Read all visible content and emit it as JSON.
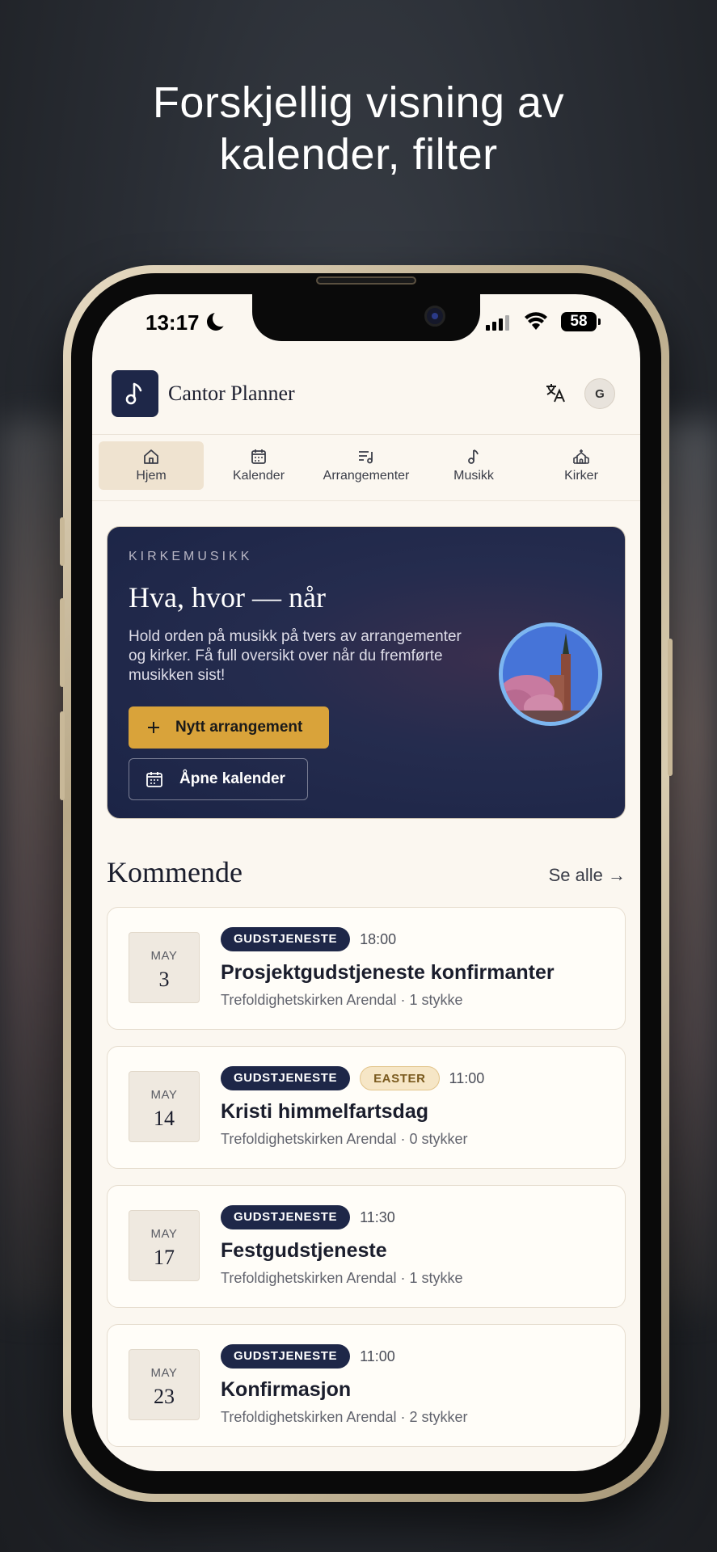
{
  "headline": {
    "line1": "Forskjellig visning av",
    "line2": "kalender, filter"
  },
  "status_bar": {
    "time": "13:17",
    "battery": "58"
  },
  "app": {
    "title": "Cantor Planner",
    "avatar_initial": "G"
  },
  "nav": {
    "items": [
      {
        "label": "Hjem",
        "icon": "home-icon",
        "active": true
      },
      {
        "label": "Kalender",
        "icon": "calendar-icon"
      },
      {
        "label": "Arrangementer",
        "icon": "list-music-icon"
      },
      {
        "label": "Musikk",
        "icon": "music-note-icon"
      },
      {
        "label": "Kirker",
        "icon": "church-icon"
      }
    ]
  },
  "hero": {
    "eyebrow": "KIRKEMUSIKK",
    "title": "Hva, hvor — når",
    "description": "Hold orden på musikk på tvers av arrangementer og kirker. Få full oversikt over når du fremførte musikken sist!",
    "primary_button": "Nytt arrangement",
    "secondary_button": "Åpne kalender"
  },
  "upcoming": {
    "title": "Kommende",
    "see_all": "Se alle →",
    "events": [
      {
        "month": "MAY",
        "day": "3",
        "badges": [
          "GUDSTJENESTE"
        ],
        "time": "18:00",
        "title": "Prosjektgudstjeneste konfirmanter",
        "subtitle": "Trefoldighetskirken Arendal · 1 stykke"
      },
      {
        "month": "MAY",
        "day": "14",
        "badges": [
          "GUDSTJENESTE",
          "EASTER"
        ],
        "time": "11:00",
        "title": "Kristi himmelfartsdag",
        "subtitle": "Trefoldighetskirken Arendal · 0 stykker"
      },
      {
        "month": "MAY",
        "day": "17",
        "badges": [
          "GUDSTJENESTE"
        ],
        "time": "11:30",
        "title": "Festgudstjeneste",
        "subtitle": "Trefoldighetskirken Arendal · 1 stykke"
      },
      {
        "month": "MAY",
        "day": "23",
        "badges": [
          "GUDSTJENESTE"
        ],
        "time": "11:00",
        "title": "Konfirmasjon",
        "subtitle": "Trefoldighetskirken Arendal · 2 stykker"
      }
    ]
  },
  "colors": {
    "navy": "#1e2748",
    "gold": "#d9a33a",
    "cream": "#fbf7f0"
  }
}
